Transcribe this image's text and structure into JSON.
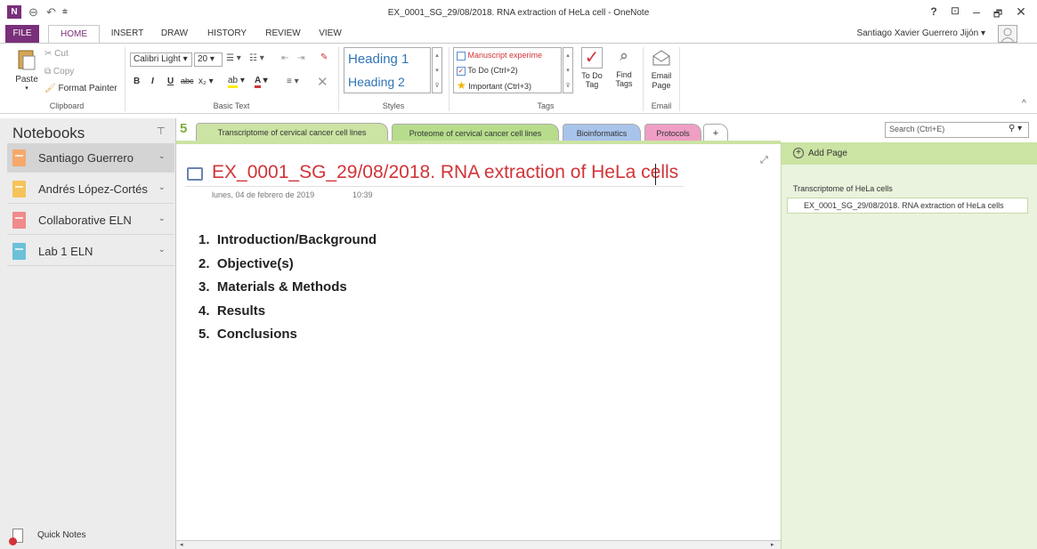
{
  "window": {
    "title": "EX_0001_SG_29/08/2018. RNA extraction of HeLa cell - OneNote",
    "app_icon": "N",
    "controls": {
      "help": "?",
      "ribbon_display": "⊡",
      "minimize": "–",
      "restore": "🗗",
      "close": "✕"
    }
  },
  "ribbon_tabs": [
    "FILE",
    "HOME",
    "INSERT",
    "DRAW",
    "HISTORY",
    "REVIEW",
    "VIEW"
  ],
  "user": {
    "name": "Santiago Xavier Guerrero Jijón"
  },
  "clipboard": {
    "paste": "Paste",
    "cut": "Cut",
    "copy": "Copy",
    "format_painter": "Format Painter",
    "label": "Clipboard"
  },
  "basic_text": {
    "font": "Calibri Light",
    "size": "20",
    "bold": "B",
    "italic": "I",
    "underline": "U",
    "strike": "abc",
    "subscript": "x₂",
    "label": "Basic Text"
  },
  "styles": {
    "heading1": "Heading 1",
    "heading2": "Heading 2",
    "label": "Styles"
  },
  "tags": {
    "items": [
      "Manuscript experime",
      "To Do (Ctrl+2)",
      "Important (Ctrl+3)"
    ],
    "todo_tag": "To Do Tag",
    "find_tags": "Find Tags",
    "label": "Tags"
  },
  "email": {
    "button": "Email Page",
    "label": "Email"
  },
  "notebooks": {
    "title": "Notebooks",
    "items": [
      {
        "label": "Santiago Guerrero",
        "color": "#f5a96c"
      },
      {
        "label": "Andrés López-Cortés",
        "color": "#f6c35b"
      },
      {
        "label": "Collaborative ELN",
        "color": "#ef8b8b"
      },
      {
        "label": "Lab 1 ELN",
        "color": "#6cc1d8"
      }
    ],
    "quick_notes": "Quick Notes"
  },
  "sections": {
    "number_icon": "5",
    "tabs": [
      {
        "label": "Transcriptome of cervical cancer cell lines",
        "color": "#cbe3a3"
      },
      {
        "label": "Proteome of cervical cancer cell lines",
        "color": "#b7dd8c"
      },
      {
        "label": "Bioinformatics",
        "color": "#a9c4eb"
      },
      {
        "label": "Protocols",
        "color": "#ef9fc4"
      }
    ],
    "add": "+"
  },
  "search": {
    "placeholder": "Search (Ctrl+E)"
  },
  "page": {
    "title": "EX_0001_SG_29/08/2018. RNA extraction of HeLa cells",
    "date": "lunes, 04 de febrero de 2019",
    "time": "10:39",
    "outline": [
      "Introduction/Background",
      "Objective(s)",
      "Materials & Methods",
      "Results",
      "Conclusions"
    ]
  },
  "pages_pane": {
    "add_page": "Add Page",
    "group": "Transcriptome of HeLa cells",
    "selected": "EX_0001_SG_29/08/2018. RNA extraction of HeLa cells"
  }
}
